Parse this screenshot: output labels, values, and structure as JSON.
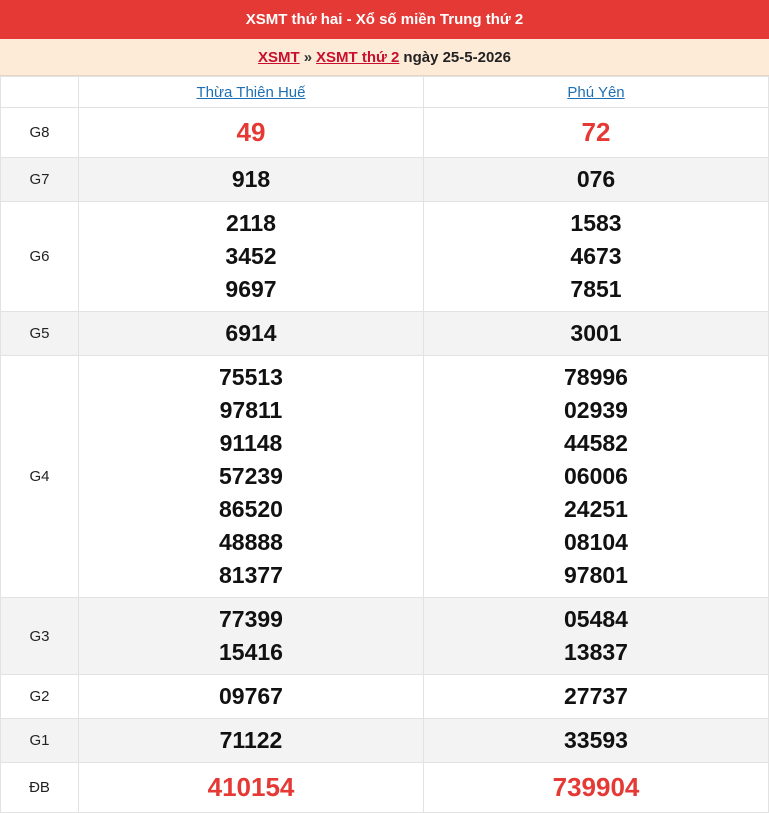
{
  "header": {
    "title": "XSMT thứ hai - Xổ số miền Trung thứ 2"
  },
  "breadcrumb": {
    "link1": "XSMT",
    "sep": "»",
    "link2": "XSMT thứ 2",
    "date": "ngày 25-5-2026"
  },
  "provinces": [
    "Thừa Thiên Huế",
    "Phú Yên"
  ],
  "prizes": [
    {
      "label": "G8",
      "values": [
        [
          "49"
        ],
        [
          "72"
        ]
      ]
    },
    {
      "label": "G7",
      "values": [
        [
          "918"
        ],
        [
          "076"
        ]
      ]
    },
    {
      "label": "G6",
      "values": [
        [
          "2118",
          "3452",
          "9697"
        ],
        [
          "1583",
          "4673",
          "7851"
        ]
      ]
    },
    {
      "label": "G5",
      "values": [
        [
          "6914"
        ],
        [
          "3001"
        ]
      ]
    },
    {
      "label": "G4",
      "values": [
        [
          "75513",
          "97811",
          "91148",
          "57239",
          "86520",
          "48888",
          "81377"
        ],
        [
          "78996",
          "02939",
          "44582",
          "06006",
          "24251",
          "08104",
          "97801"
        ]
      ]
    },
    {
      "label": "G3",
      "values": [
        [
          "77399",
          "15416"
        ],
        [
          "05484",
          "13837"
        ]
      ]
    },
    {
      "label": "G2",
      "values": [
        [
          "09767"
        ],
        [
          "27737"
        ]
      ]
    },
    {
      "label": "G1",
      "values": [
        [
          "71122"
        ],
        [
          "33593"
        ]
      ]
    },
    {
      "label": "ĐB",
      "values": [
        [
          "410154"
        ],
        [
          "739904"
        ]
      ]
    }
  ]
}
